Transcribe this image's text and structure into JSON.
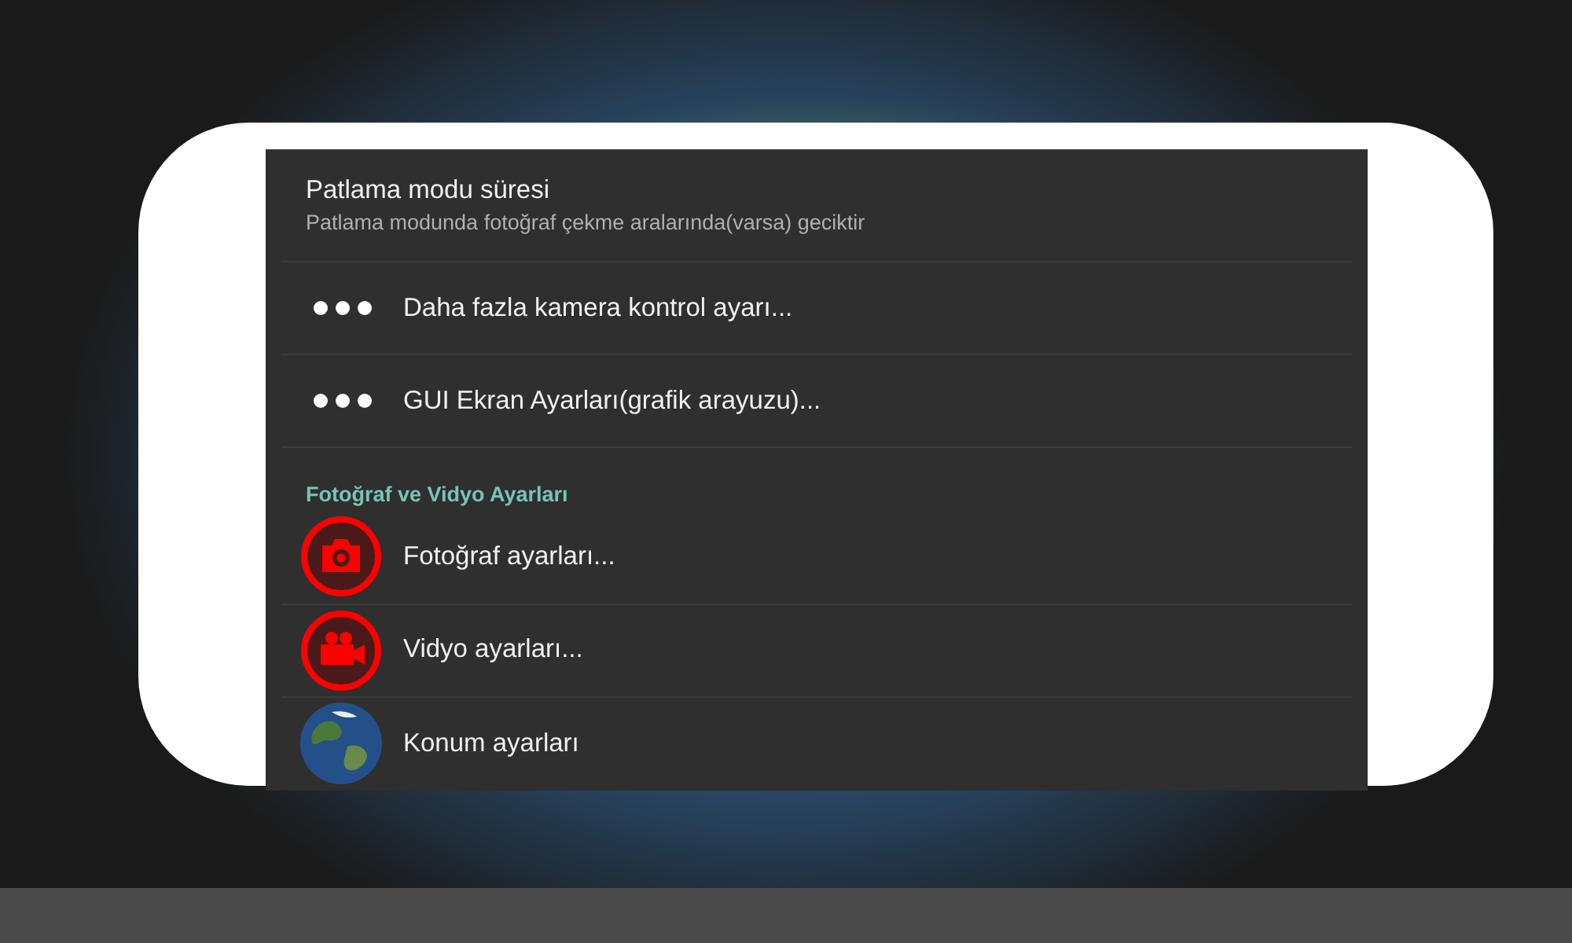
{
  "settings": [
    {
      "kind": "summary",
      "title": "Patlama modu süresi",
      "summary": "Patlama modunda fotoğraf çekme aralarında(varsa) geciktir"
    },
    {
      "kind": "dots",
      "title": "Daha fazla kamera kontrol ayarı..."
    },
    {
      "kind": "dots",
      "title": "GUI Ekran Ayarları(grafik arayuzu)..."
    },
    {
      "kind": "category",
      "title": "Fotoğraf ve Vidyo Ayarları"
    },
    {
      "kind": "camera",
      "title": "Fotoğraf ayarları..."
    },
    {
      "kind": "video",
      "title": "Vidyo ayarları..."
    },
    {
      "kind": "globe",
      "title": "Konum ayarları"
    }
  ]
}
